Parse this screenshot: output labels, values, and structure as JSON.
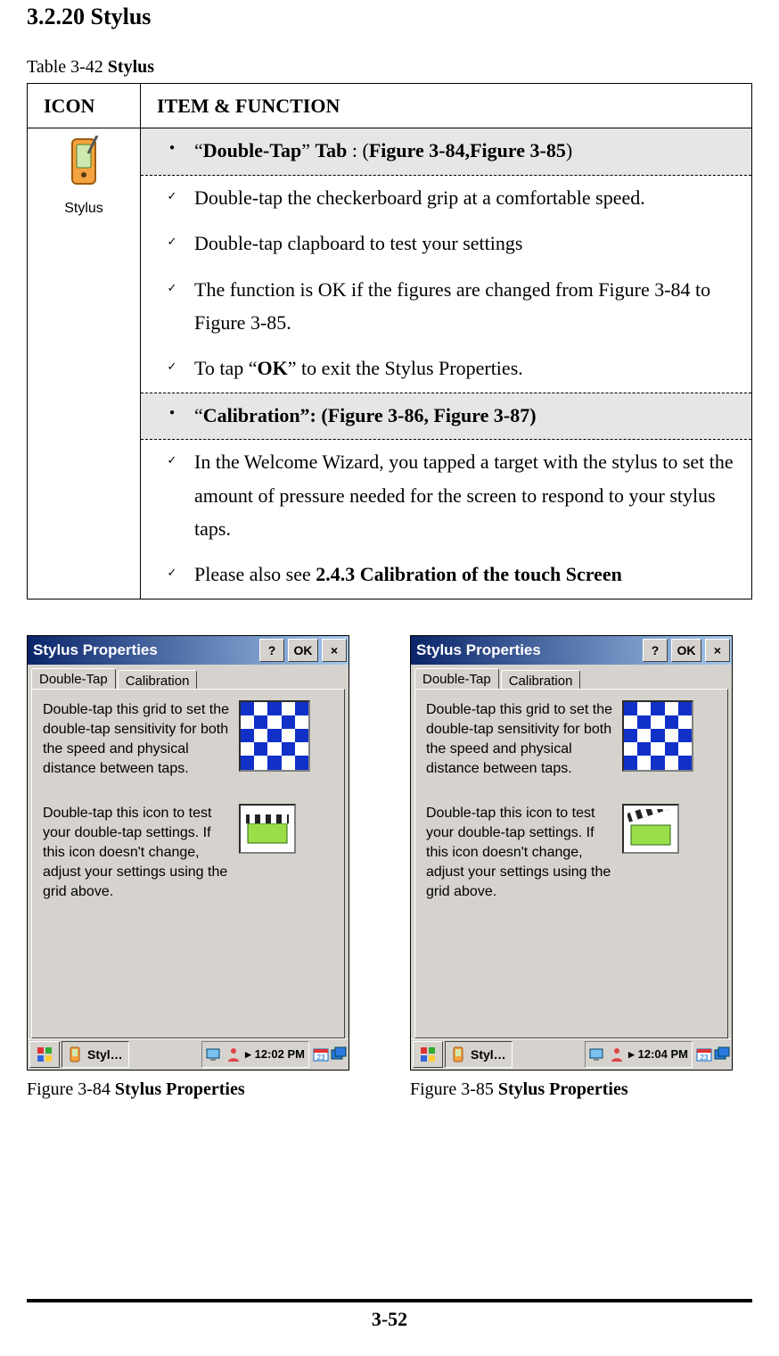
{
  "heading": "3.2.20 Stylus",
  "table_label": {
    "prefix": "Table 3-42 ",
    "name": "Stylus"
  },
  "table": {
    "headers": {
      "icon": "ICON",
      "item": "ITEM & FUNCTION"
    },
    "icon_caption": "Stylus",
    "rows": [
      {
        "kind": "bullet_grey",
        "html": "“<b>Double-Tap</b>” <b>Tab</b> : (<b>Figure 3-84,Figure 3-85</b>)"
      },
      {
        "kind": "check",
        "html": "Double-tap the checkerboard grip at a comfortable speed."
      },
      {
        "kind": "check",
        "html": "Double-tap clapboard to test your settings"
      },
      {
        "kind": "check",
        "html": "The function is OK if the figures are changed from Figure 3-84 to Figure 3-85."
      },
      {
        "kind": "check",
        "html": "To tap “<b>OK</b>” to exit the Stylus Properties."
      },
      {
        "kind": "bullet_grey",
        "html": "“<b>Calibration”: (Figure 3-86, Figure 3-87)</b>"
      },
      {
        "kind": "check",
        "html": "In the Welcome Wizard, you tapped a target with the stylus to set the amount of pressure needed for the screen to respond to your stylus taps."
      },
      {
        "kind": "check",
        "html": "Please also see <b>2.4.3 Calibration of the touch Screen</b>"
      }
    ]
  },
  "dialog": {
    "title": "Stylus Properties",
    "btn_help": "?",
    "btn_ok": "OK",
    "btn_close": "×",
    "tab_active": "Double-Tap",
    "tab_other": "Calibration",
    "para1": "Double-tap this grid to set the double-tap sensitivity for both the speed and physical distance between taps.",
    "para2": "Double-tap this icon to test your double-tap settings. If this icon doesn't change, adjust your settings using the grid above.",
    "taskbtn": "Styl…",
    "tray_arrow": "▸"
  },
  "shots": [
    {
      "time": "12:02 PM",
      "variant": "closed",
      "caption_prefix": "Figure 3-84 ",
      "caption_name": "Stylus Properties"
    },
    {
      "time": "12:04 PM",
      "variant": "open",
      "caption_prefix": "Figure 3-85 ",
      "caption_name": "Stylus Properties"
    }
  ],
  "page_number": "3-52",
  "icons": {
    "flag": "flag-icon",
    "stylus_small": "stylus-small-icon",
    "desktop": "desktop-icon",
    "person": "person-icon",
    "calendar": "calendar-icon",
    "windows": "windows-icon",
    "clapboard_closed": "clapboard-closed-icon",
    "clapboard_open": "clapboard-open-icon"
  }
}
